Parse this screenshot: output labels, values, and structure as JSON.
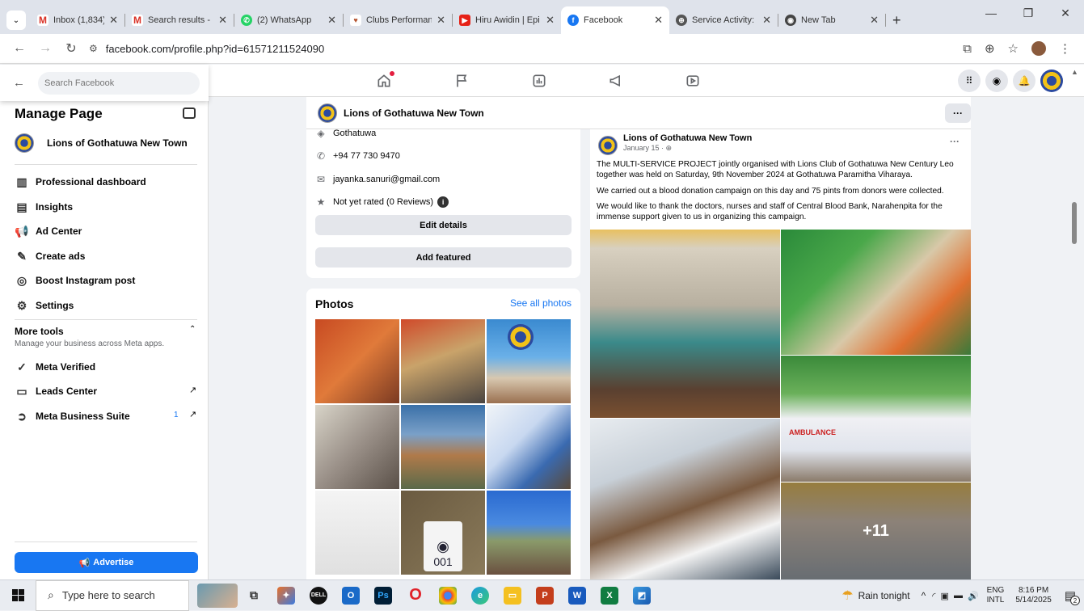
{
  "browser": {
    "tabs": [
      {
        "title": "Inbox (1,834) - ja",
        "icon": "gmail-icon",
        "color": "#d93025",
        "glyph": "M"
      },
      {
        "title": "Search results - ",
        "icon": "gmail-icon",
        "color": "#d93025",
        "glyph": "M"
      },
      {
        "title": "(2) WhatsApp",
        "icon": "whatsapp-icon",
        "color": "#25d366",
        "glyph": "✆"
      },
      {
        "title": "Clubs Performan",
        "icon": "lions-icon",
        "color": "#b5522e",
        "glyph": "♥"
      },
      {
        "title": "Hiru Awidin | Epi",
        "icon": "youtube-icon",
        "color": "#e62117",
        "glyph": "▶"
      },
      {
        "title": "Facebook",
        "icon": "facebook-icon",
        "color": "#1877f2",
        "glyph": "f"
      },
      {
        "title": "Service Activity:",
        "icon": "globe-icon",
        "color": "#555555",
        "glyph": "⊕"
      },
      {
        "title": "New Tab",
        "icon": "chrome-icon",
        "color": "#444444",
        "glyph": "◉"
      }
    ],
    "url": "facebook.com/profile.php?id=61571211524090"
  },
  "fb": {
    "search_placeholder": "Search Facebook",
    "page_name": "Lions of Gothatuwa New Town"
  },
  "sidebar": {
    "title": "Manage Page",
    "page_name": "Lions of Gothatuwa New Town",
    "items": [
      {
        "label": "Professional dashboard",
        "icon": "dashboard-icon"
      },
      {
        "label": "Insights",
        "icon": "insights-icon"
      },
      {
        "label": "Ad Center",
        "icon": "megaphone-icon"
      },
      {
        "label": "Create ads",
        "icon": "pencil-icon"
      },
      {
        "label": "Boost Instagram post",
        "icon": "instagram-icon"
      },
      {
        "label": "Settings",
        "icon": "gear-icon"
      }
    ],
    "more_tools": "More tools",
    "more_tools_sub": "Manage your business across Meta apps.",
    "tools": [
      {
        "label": "Meta Verified",
        "icon": "verified-icon"
      },
      {
        "label": "Leads Center",
        "icon": "leads-icon"
      },
      {
        "label": "Meta Business Suite",
        "icon": "business-suite-icon",
        "badge": "1"
      }
    ],
    "advertise": "Advertise"
  },
  "intro": {
    "location": "Gothatuwa",
    "phone": "+94 77 730 9470",
    "email": "jayanka.sanuri@gmail.com",
    "rating": "Not yet rated (0 Reviews)",
    "edit_details": "Edit details",
    "add_featured": "Add featured"
  },
  "photos": {
    "title": "Photos",
    "see_all": "See all photos",
    "badge_number": "001"
  },
  "post": {
    "author": "Lions of Gothatuwa New Town",
    "date": "January 15 · ",
    "p1": "The MULTI-SERVICE PROJECT jointly organised with Lions Club of Gothatuwa New Century Leo together was held on Saturday, 9th November 2024 at Gothatuwa Paramitha Viharaya.",
    "p2": "We carried out a blood donation campaign on this day and 75 pints from donors were collected.",
    "p3": "We would like to thank the doctors, nurses and staff of Central Blood Bank, Narahenpita for the immense support given to us in organizing this campaign.",
    "more_count": "+11",
    "ambulance_text": "AMBULANCE"
  },
  "taskbar": {
    "search": "Type here to search",
    "weather": "Rain tonight",
    "lang1": "ENG",
    "lang2": "INTL",
    "time": "8:16 PM",
    "date": "5/14/2025",
    "notif": "2"
  }
}
